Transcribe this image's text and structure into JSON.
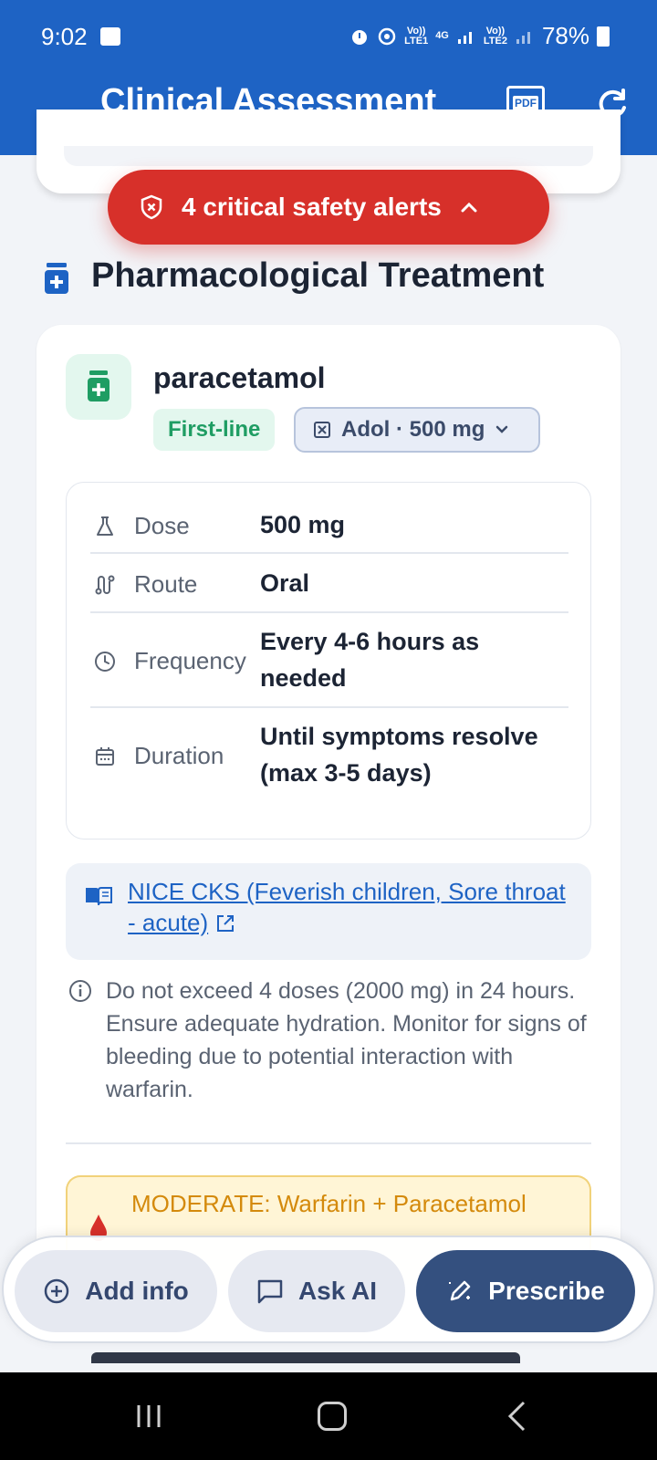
{
  "status_bar": {
    "time": "9:02",
    "net1_top": "Vo))",
    "net1_bottom": "LTE1",
    "net_type": "4G",
    "net2_top": "Vo))",
    "net2_bottom": "LTE2",
    "battery": "78%"
  },
  "app_bar": {
    "title": "Clinical Assessment",
    "pdf_label": "PDF",
    "icons": [
      "pdf-icon",
      "refresh-icon"
    ]
  },
  "alert": {
    "text": "4 critical safety alerts",
    "color": "#d7302a"
  },
  "section": {
    "title": "Pharmacological Treatment"
  },
  "drug": {
    "name": "paracetamol",
    "line_badge": "First-line",
    "brand": "Adol · 500 mg",
    "details": [
      {
        "label": "Dose",
        "value": "500 mg",
        "icon": "flask-icon"
      },
      {
        "label": "Route",
        "value": "Oral",
        "icon": "route-icon"
      },
      {
        "label": "Frequency",
        "value": "Every 4-6 hours as needed",
        "icon": "clock-icon"
      },
      {
        "label": "Duration",
        "value": "Until symptoms resolve (max 3-5 days)",
        "icon": "calendar-icon"
      }
    ],
    "reference": "NICE CKS (Feverish children, Sore throat - acute)",
    "note": "Do not exceed 4 doses (2000 mg) in 24 hours. Ensure adequate hydration. Monitor for signs of bleeding due to potential interaction with warfarin.",
    "interaction": "MODERATE: Warfarin + Paracetamol"
  },
  "actions": {
    "add_info": "Add info",
    "ask_ai": "Ask AI",
    "prescribe": "Prescribe"
  },
  "colors": {
    "primary": "#1e63c4",
    "success": "#1f9d63",
    "warning": "#d48a0c",
    "prescribe": "#34507f"
  }
}
